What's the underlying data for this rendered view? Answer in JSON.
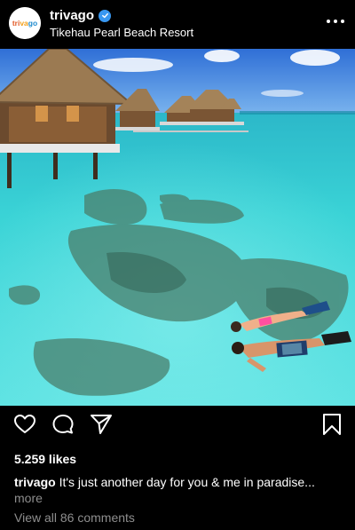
{
  "post": {
    "username": "trivago",
    "location": "Tikehau Pearl Beach Resort",
    "avatar_logo_text": "trivago",
    "likes": "5.259 likes",
    "caption_user": "trivago",
    "caption_text": "It's just another day for you & me in paradise...",
    "caption_more": "more",
    "view_comments": "View all 86 comments"
  },
  "icons": {
    "more": "more-options-icon",
    "verified": "verified-badge-icon",
    "like": "heart-icon",
    "comment": "comment-bubble-icon",
    "share": "paper-plane-icon",
    "save": "bookmark-icon"
  },
  "colors": {
    "background": "#000000",
    "text": "#ffffff",
    "muted": "#8e8e8e",
    "verified": "#3897f0"
  }
}
